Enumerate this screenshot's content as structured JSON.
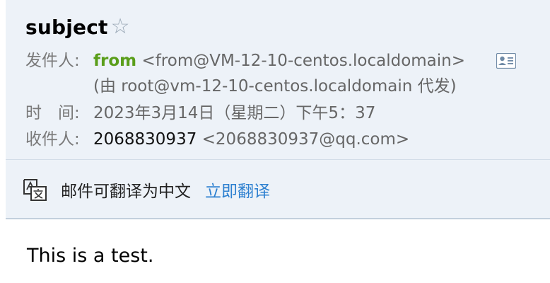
{
  "email": {
    "subject": "subject",
    "star_icon": "☆",
    "sender": {
      "label": "发件人:",
      "name": "from",
      "address": "<from@VM-12-10-centos.localdomain>",
      "on_behalf": "(由 root@vm-12-10-centos.localdomain 代发)"
    },
    "time": {
      "label": "时　间:",
      "value": "2023年3月14日（星期二）下午5：37"
    },
    "recipient": {
      "label": "收件人:",
      "name": "2068830937",
      "address": "<2068830937@qq.com>"
    },
    "translate": {
      "text": "邮件可翻译为中文",
      "link": "立即翻译"
    },
    "body": "This is a test."
  },
  "colors": {
    "header_bg": "#edf2f8",
    "sender_name": "#5a9e1a",
    "link": "#2d80d0"
  },
  "icons": [
    "star-icon",
    "contact-card-icon",
    "translate-icon"
  ]
}
